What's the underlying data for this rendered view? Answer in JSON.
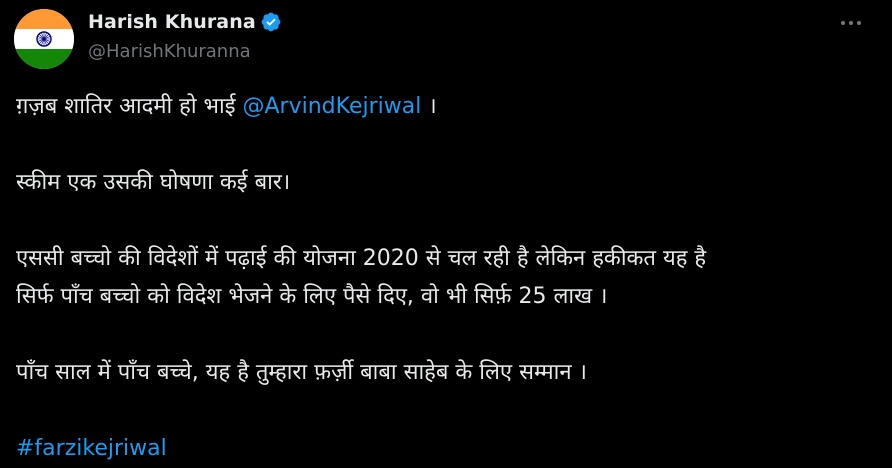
{
  "author": {
    "display_name": "Harish Khurana",
    "handle": "@HarishKhuranna",
    "verified_icon": "verified-badge-icon",
    "avatar_icon": "indian-flag-avatar",
    "avatar_colors": {
      "saffron": "#FF9933",
      "white": "#FFFFFF",
      "green": "#138808",
      "chakra": "#000080"
    }
  },
  "more_icon": "more-options-icon",
  "tweet": {
    "line1_text": "ग़ज़ब शातिर आदमी हो भाई ",
    "mention": "@ArvindKejriwal",
    "line1_end": " ।",
    "line2": "स्कीम एक उसकी घोषणा कई बार।",
    "line3": "एससी बच्चो की विदेशों में पढ़ाई की योजना 2020 से चल रही है लेकिन हकीकत यह है",
    "line4": "सिर्फ पाँच बच्चो को विदेश भेजने के लिए पैसे दिए, वो भी सिर्फ़ 25 लाख ।",
    "line5": "पाँच साल में पाँच बच्चे, यह है तुम्हारा फ़र्ज़ी बाबा साहेब के लिए सम्मान ।",
    "hashtag": "#farzikejriwal"
  },
  "colors": {
    "background": "#000000",
    "text_primary": "#e7e9ea",
    "text_secondary": "#71767b",
    "link": "#1d9bf0"
  }
}
